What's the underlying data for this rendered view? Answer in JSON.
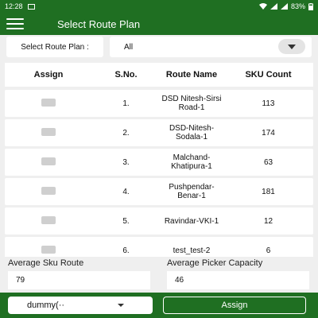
{
  "status": {
    "time": "12:28",
    "battery": "83%"
  },
  "appbar": {
    "title": "Select Route Plan"
  },
  "filter": {
    "label": "Select Route Plan :",
    "value": "All"
  },
  "table": {
    "headers": {
      "assign": "Assign",
      "sno": "S.No.",
      "name": "Route Name",
      "sku": "SKU Count"
    },
    "rows": [
      {
        "sno": "1.",
        "name": "DSD Nitesh-Sirsi Road-1",
        "sku": "113"
      },
      {
        "sno": "2.",
        "name": "DSD-Nitesh-Sodala-1",
        "sku": "174"
      },
      {
        "sno": "3.",
        "name": "Malchand-Khatipura-1",
        "sku": "63"
      },
      {
        "sno": "4.",
        "name": "Pushpendar-Benar-1",
        "sku": "181"
      },
      {
        "sno": "5.",
        "name": "Ravindar-VKI-1",
        "sku": "12"
      },
      {
        "sno": "6.",
        "name": "test_test-2",
        "sku": "6"
      }
    ]
  },
  "summary": {
    "avg_sku_label": "Average Sku Route",
    "avg_sku_value": "79",
    "avg_picker_label": "Average Picker Capacity",
    "avg_picker_value": "46"
  },
  "footer": {
    "user_value": "dummy(··",
    "assign_label": "Assign"
  }
}
